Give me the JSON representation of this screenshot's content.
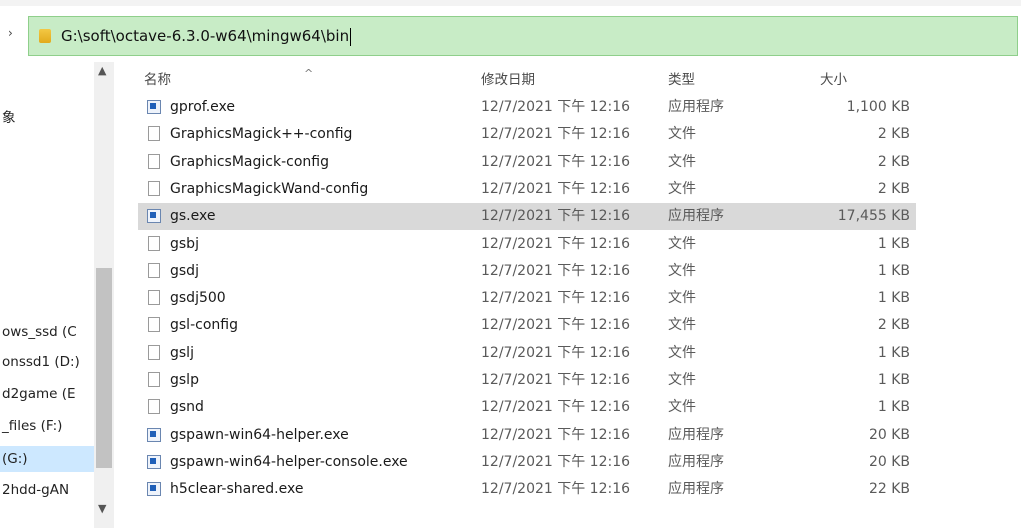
{
  "address_bar": {
    "path": "G:\\soft\\octave-6.3.0-w64\\mingw64\\bin"
  },
  "nav_pane": {
    "items": [
      {
        "label": "象"
      },
      {
        "label": "ows_ssd (C"
      },
      {
        "label": "onssd1 (D:)"
      },
      {
        "label": "d2game (E"
      },
      {
        "label": "_files (F:)"
      },
      {
        "label": "(G:)"
      },
      {
        "label": "2hdd-gAN"
      }
    ]
  },
  "columns": {
    "name": "名称",
    "date": "修改日期",
    "type": "类型",
    "size": "大小"
  },
  "files": [
    {
      "name": "gprof.exe",
      "date": "12/7/2021 下午 12:16",
      "type": "应用程序",
      "size": "1,100 KB",
      "icon": "exe-icon"
    },
    {
      "name": "GraphicsMagick++-config",
      "date": "12/7/2021 下午 12:16",
      "type": "文件",
      "size": "2 KB",
      "icon": "file-icon"
    },
    {
      "name": "GraphicsMagick-config",
      "date": "12/7/2021 下午 12:16",
      "type": "文件",
      "size": "2 KB",
      "icon": "file-icon"
    },
    {
      "name": "GraphicsMagickWand-config",
      "date": "12/7/2021 下午 12:16",
      "type": "文件",
      "size": "2 KB",
      "icon": "file-icon"
    },
    {
      "name": "gs.exe",
      "date": "12/7/2021 下午 12:16",
      "type": "应用程序",
      "size": "17,455 KB",
      "icon": "exe-icon",
      "selected": true
    },
    {
      "name": "gsbj",
      "date": "12/7/2021 下午 12:16",
      "type": "文件",
      "size": "1 KB",
      "icon": "file-icon"
    },
    {
      "name": "gsdj",
      "date": "12/7/2021 下午 12:16",
      "type": "文件",
      "size": "1 KB",
      "icon": "file-icon"
    },
    {
      "name": "gsdj500",
      "date": "12/7/2021 下午 12:16",
      "type": "文件",
      "size": "1 KB",
      "icon": "file-icon"
    },
    {
      "name": "gsl-config",
      "date": "12/7/2021 下午 12:16",
      "type": "文件",
      "size": "2 KB",
      "icon": "file-icon"
    },
    {
      "name": "gslj",
      "date": "12/7/2021 下午 12:16",
      "type": "文件",
      "size": "1 KB",
      "icon": "file-icon"
    },
    {
      "name": "gslp",
      "date": "12/7/2021 下午 12:16",
      "type": "文件",
      "size": "1 KB",
      "icon": "file-icon"
    },
    {
      "name": "gsnd",
      "date": "12/7/2021 下午 12:16",
      "type": "文件",
      "size": "1 KB",
      "icon": "file-icon"
    },
    {
      "name": "gspawn-win64-helper.exe",
      "date": "12/7/2021 下午 12:16",
      "type": "应用程序",
      "size": "20 KB",
      "icon": "exe-icon"
    },
    {
      "name": "gspawn-win64-helper-console.exe",
      "date": "12/7/2021 下午 12:16",
      "type": "应用程序",
      "size": "20 KB",
      "icon": "exe-icon"
    },
    {
      "name": "h5clear-shared.exe",
      "date": "12/7/2021 下午 12:16",
      "type": "应用程序",
      "size": "22 KB",
      "icon": "exe-icon"
    }
  ],
  "colors": {
    "address_bar_bg": "#c8ecc6",
    "selected_row_bg": "#d9d9d9",
    "exe_icon_blue": "#1f5fb8"
  }
}
